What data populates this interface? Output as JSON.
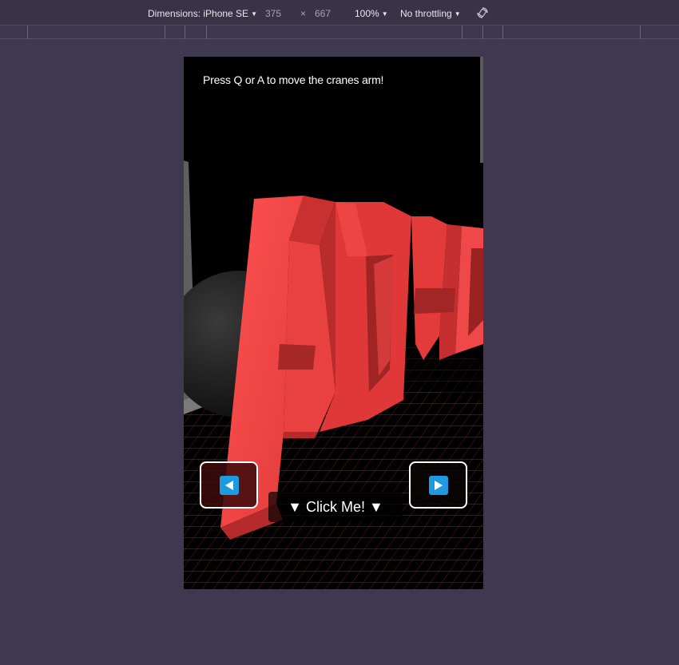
{
  "devtools": {
    "dimensions_label": "Dimensions: iPhone SE",
    "width": "375",
    "times": "×",
    "height": "667",
    "zoom": "100%",
    "throttling": "No throttling",
    "caret": "▼"
  },
  "app": {
    "instructions": "Press Q or A to move the cranes arm!",
    "logo_text": "ADHD",
    "click_me": "▼ Click Me! ▼",
    "colors": {
      "letters": "#ff4a4a",
      "grid": "#ff2a2a",
      "button_icon": "#1e9be0"
    }
  }
}
